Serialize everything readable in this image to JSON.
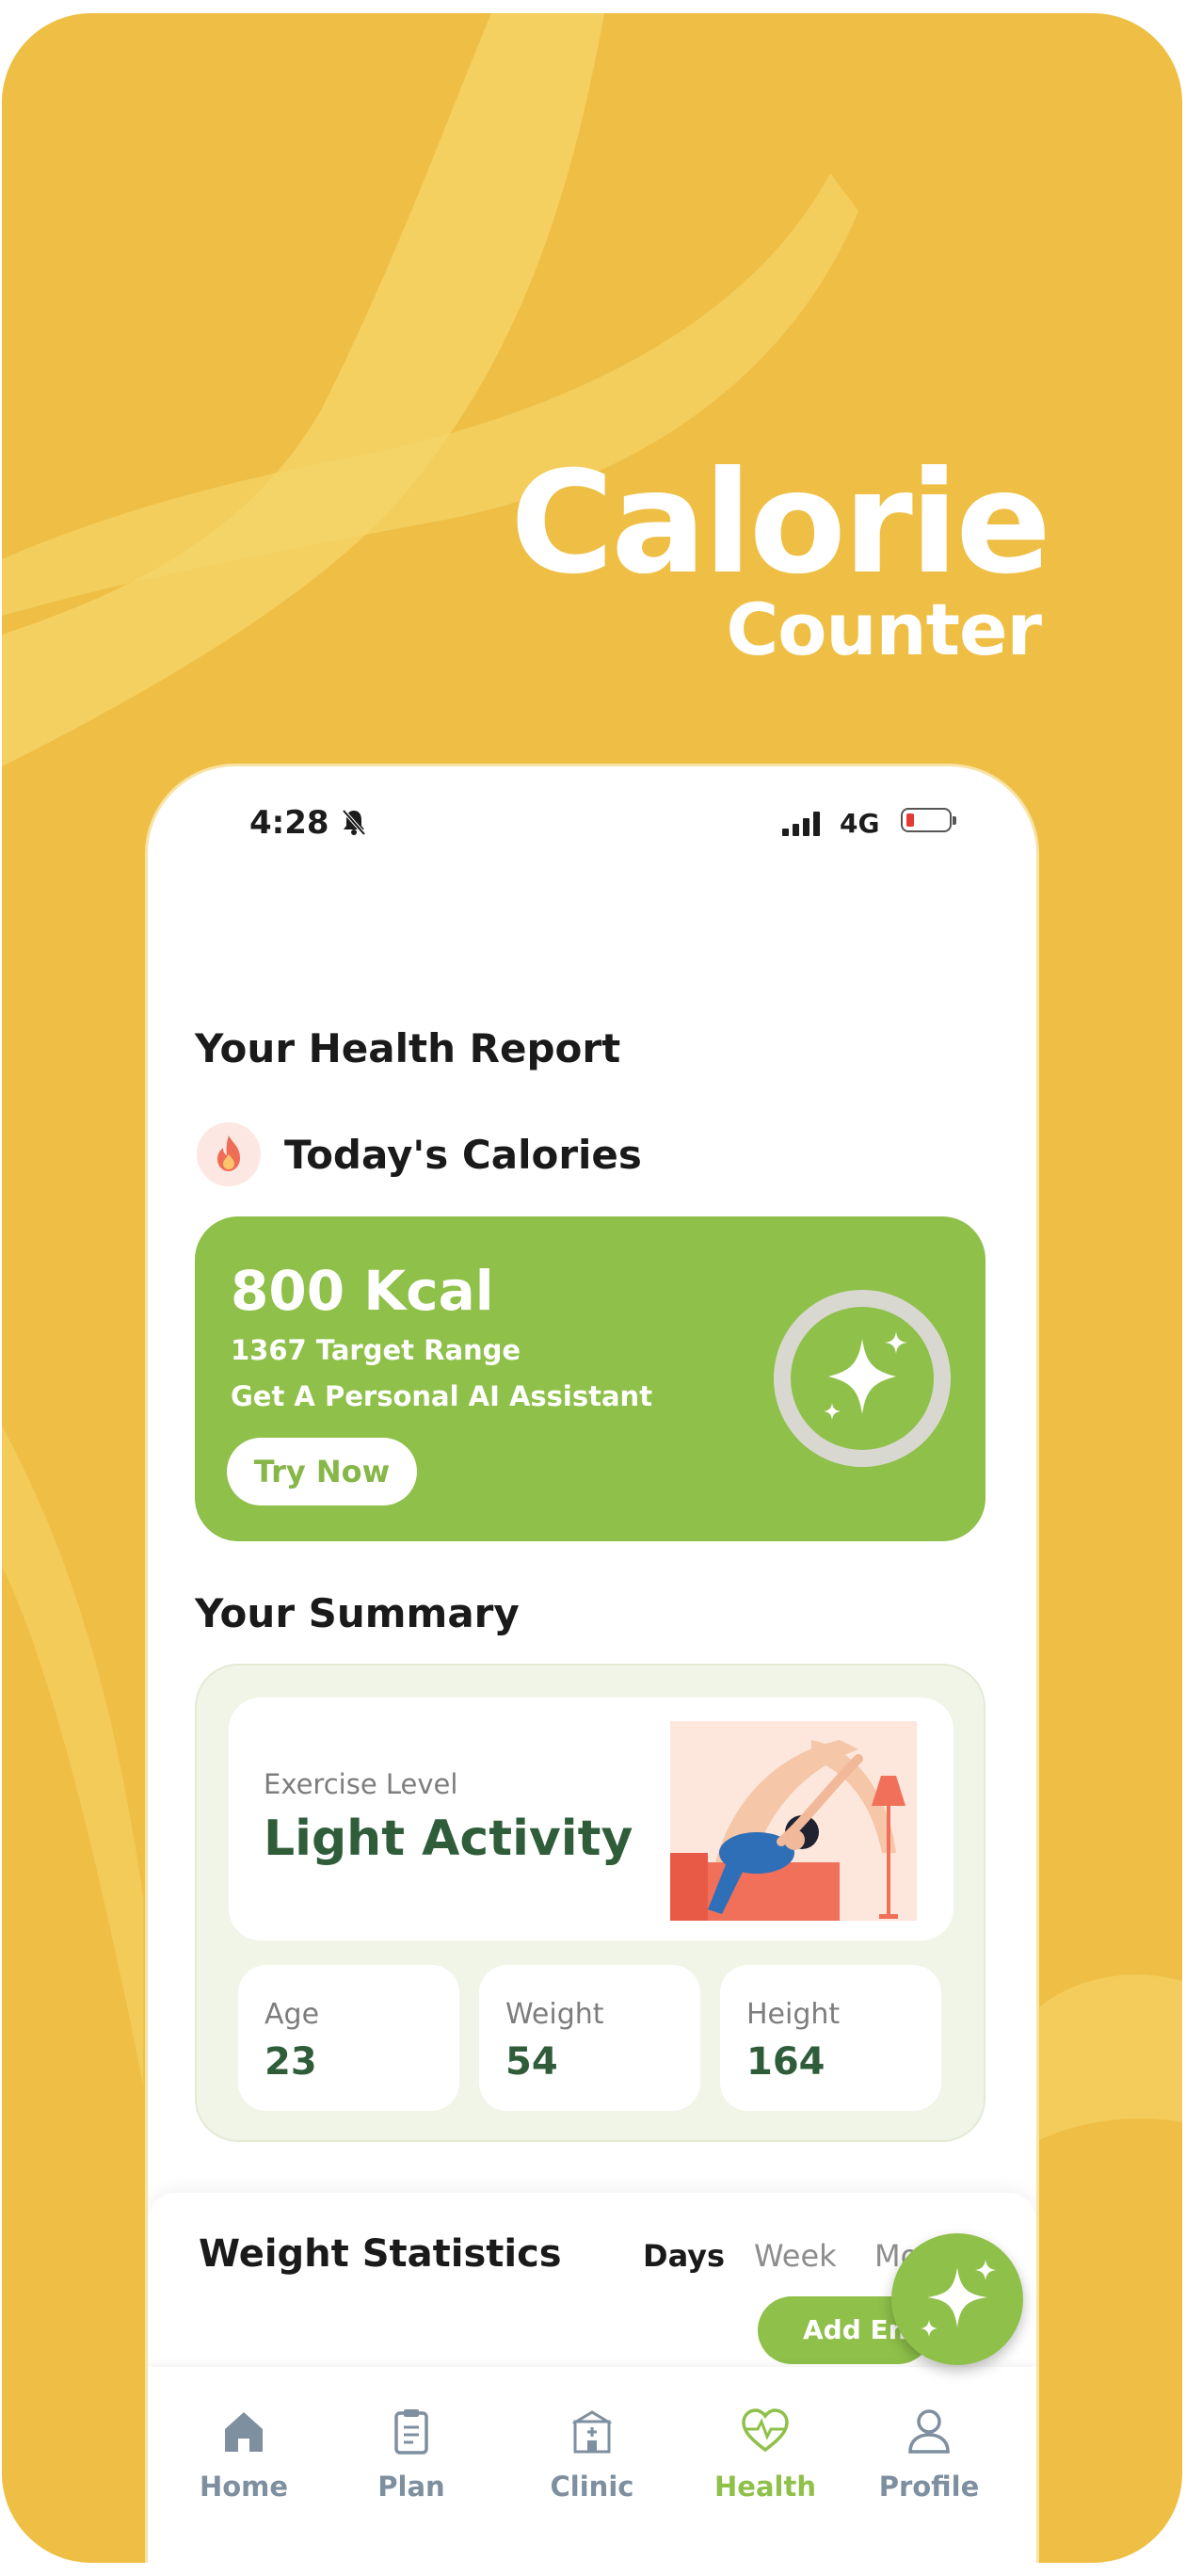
{
  "promo": {
    "title": "Calorie",
    "subtitle": "Counter"
  },
  "status_bar": {
    "time": "4:28",
    "network": "4G",
    "battery_level": 0.12
  },
  "health_report": {
    "heading": "Your Health Report",
    "calories_heading": "Today's Calories",
    "card": {
      "kcal": "800 Kcal",
      "target": "1367 Target Range",
      "assistant": "Get A Personal AI Assistant",
      "try_button": "Try Now"
    }
  },
  "summary": {
    "heading": "Your Summary",
    "exercise_label": "Exercise Level",
    "exercise_value": "Light Activity",
    "stats": [
      {
        "label": "Age",
        "value": "23"
      },
      {
        "label": "Weight",
        "value": "54"
      },
      {
        "label": "Height",
        "value": "164"
      }
    ]
  },
  "weight_statistics": {
    "title": "Weight Statistics",
    "tabs": [
      "Days",
      "Week",
      "Month"
    ],
    "active_tab": "Days",
    "add_button": "Add Entry"
  },
  "nav": {
    "items": [
      {
        "label": "Home",
        "icon": "home-icon"
      },
      {
        "label": "Plan",
        "icon": "clipboard-icon"
      },
      {
        "label": "Clinic",
        "icon": "clinic-icon"
      },
      {
        "label": "Health",
        "icon": "heart-pulse-icon"
      },
      {
        "label": "Profile",
        "icon": "user-icon"
      }
    ],
    "active": "Health"
  },
  "colors": {
    "background": "#efbf45",
    "accent": "#8fc04a",
    "dark_green": "#2f5d3a"
  }
}
